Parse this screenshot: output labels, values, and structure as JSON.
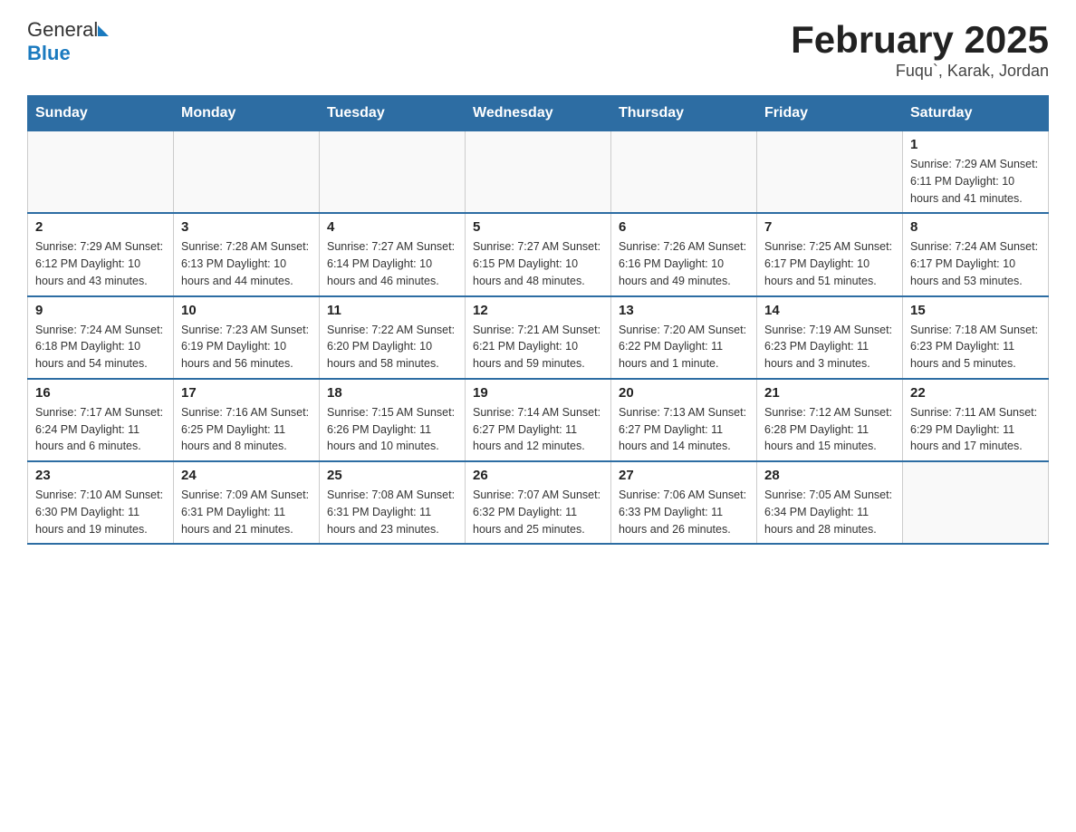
{
  "header": {
    "logo_text_general": "General",
    "logo_text_blue": "Blue",
    "title": "February 2025",
    "subtitle": "Fuqu`, Karak, Jordan"
  },
  "calendar": {
    "days_of_week": [
      "Sunday",
      "Monday",
      "Tuesday",
      "Wednesday",
      "Thursday",
      "Friday",
      "Saturday"
    ],
    "weeks": [
      [
        {
          "day": "",
          "info": ""
        },
        {
          "day": "",
          "info": ""
        },
        {
          "day": "",
          "info": ""
        },
        {
          "day": "",
          "info": ""
        },
        {
          "day": "",
          "info": ""
        },
        {
          "day": "",
          "info": ""
        },
        {
          "day": "1",
          "info": "Sunrise: 7:29 AM\nSunset: 6:11 PM\nDaylight: 10 hours\nand 41 minutes."
        }
      ],
      [
        {
          "day": "2",
          "info": "Sunrise: 7:29 AM\nSunset: 6:12 PM\nDaylight: 10 hours\nand 43 minutes."
        },
        {
          "day": "3",
          "info": "Sunrise: 7:28 AM\nSunset: 6:13 PM\nDaylight: 10 hours\nand 44 minutes."
        },
        {
          "day": "4",
          "info": "Sunrise: 7:27 AM\nSunset: 6:14 PM\nDaylight: 10 hours\nand 46 minutes."
        },
        {
          "day": "5",
          "info": "Sunrise: 7:27 AM\nSunset: 6:15 PM\nDaylight: 10 hours\nand 48 minutes."
        },
        {
          "day": "6",
          "info": "Sunrise: 7:26 AM\nSunset: 6:16 PM\nDaylight: 10 hours\nand 49 minutes."
        },
        {
          "day": "7",
          "info": "Sunrise: 7:25 AM\nSunset: 6:17 PM\nDaylight: 10 hours\nand 51 minutes."
        },
        {
          "day": "8",
          "info": "Sunrise: 7:24 AM\nSunset: 6:17 PM\nDaylight: 10 hours\nand 53 minutes."
        }
      ],
      [
        {
          "day": "9",
          "info": "Sunrise: 7:24 AM\nSunset: 6:18 PM\nDaylight: 10 hours\nand 54 minutes."
        },
        {
          "day": "10",
          "info": "Sunrise: 7:23 AM\nSunset: 6:19 PM\nDaylight: 10 hours\nand 56 minutes."
        },
        {
          "day": "11",
          "info": "Sunrise: 7:22 AM\nSunset: 6:20 PM\nDaylight: 10 hours\nand 58 minutes."
        },
        {
          "day": "12",
          "info": "Sunrise: 7:21 AM\nSunset: 6:21 PM\nDaylight: 10 hours\nand 59 minutes."
        },
        {
          "day": "13",
          "info": "Sunrise: 7:20 AM\nSunset: 6:22 PM\nDaylight: 11 hours\nand 1 minute."
        },
        {
          "day": "14",
          "info": "Sunrise: 7:19 AM\nSunset: 6:23 PM\nDaylight: 11 hours\nand 3 minutes."
        },
        {
          "day": "15",
          "info": "Sunrise: 7:18 AM\nSunset: 6:23 PM\nDaylight: 11 hours\nand 5 minutes."
        }
      ],
      [
        {
          "day": "16",
          "info": "Sunrise: 7:17 AM\nSunset: 6:24 PM\nDaylight: 11 hours\nand 6 minutes."
        },
        {
          "day": "17",
          "info": "Sunrise: 7:16 AM\nSunset: 6:25 PM\nDaylight: 11 hours\nand 8 minutes."
        },
        {
          "day": "18",
          "info": "Sunrise: 7:15 AM\nSunset: 6:26 PM\nDaylight: 11 hours\nand 10 minutes."
        },
        {
          "day": "19",
          "info": "Sunrise: 7:14 AM\nSunset: 6:27 PM\nDaylight: 11 hours\nand 12 minutes."
        },
        {
          "day": "20",
          "info": "Sunrise: 7:13 AM\nSunset: 6:27 PM\nDaylight: 11 hours\nand 14 minutes."
        },
        {
          "day": "21",
          "info": "Sunrise: 7:12 AM\nSunset: 6:28 PM\nDaylight: 11 hours\nand 15 minutes."
        },
        {
          "day": "22",
          "info": "Sunrise: 7:11 AM\nSunset: 6:29 PM\nDaylight: 11 hours\nand 17 minutes."
        }
      ],
      [
        {
          "day": "23",
          "info": "Sunrise: 7:10 AM\nSunset: 6:30 PM\nDaylight: 11 hours\nand 19 minutes."
        },
        {
          "day": "24",
          "info": "Sunrise: 7:09 AM\nSunset: 6:31 PM\nDaylight: 11 hours\nand 21 minutes."
        },
        {
          "day": "25",
          "info": "Sunrise: 7:08 AM\nSunset: 6:31 PM\nDaylight: 11 hours\nand 23 minutes."
        },
        {
          "day": "26",
          "info": "Sunrise: 7:07 AM\nSunset: 6:32 PM\nDaylight: 11 hours\nand 25 minutes."
        },
        {
          "day": "27",
          "info": "Sunrise: 7:06 AM\nSunset: 6:33 PM\nDaylight: 11 hours\nand 26 minutes."
        },
        {
          "day": "28",
          "info": "Sunrise: 7:05 AM\nSunset: 6:34 PM\nDaylight: 11 hours\nand 28 minutes."
        },
        {
          "day": "",
          "info": ""
        }
      ]
    ]
  }
}
